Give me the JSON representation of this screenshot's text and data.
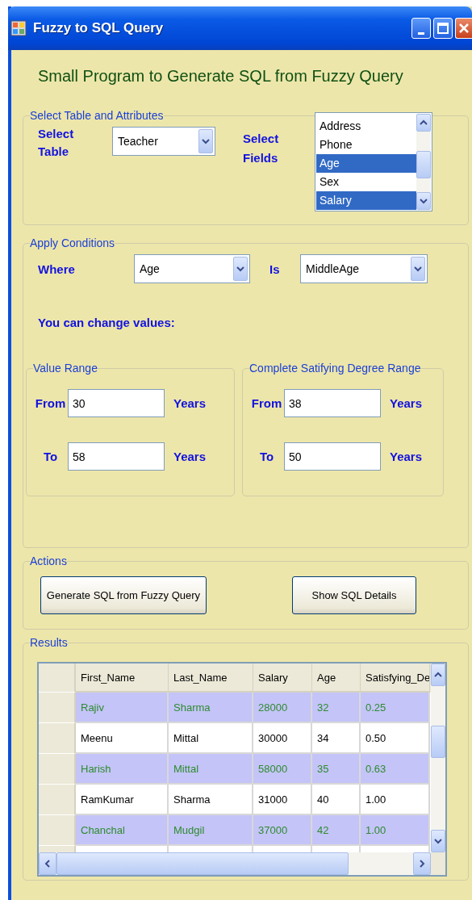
{
  "window": {
    "title": "Fuzzy to SQL Query"
  },
  "heading": "Small Program to Generate SQL from Fuzzy Query",
  "table_group": {
    "title": "Select Table and Attributes",
    "table_label": "Select Table",
    "table_value": "Teacher",
    "fields_label": "Select Fields",
    "fields": [
      {
        "label": "Address",
        "selected": false
      },
      {
        "label": "Phone",
        "selected": false
      },
      {
        "label": "Age",
        "selected": true
      },
      {
        "label": "Sex",
        "selected": false
      },
      {
        "label": "Salary",
        "selected": true
      }
    ]
  },
  "conditions": {
    "title": "Apply Conditions",
    "where_label": "Where",
    "attribute": "Age",
    "is_label": "Is",
    "term": "MiddleAge",
    "hint": "You can change values:",
    "ranges": [
      {
        "title": "Value Range",
        "rows": [
          {
            "label": "From",
            "value": "30",
            "unit": "Years"
          },
          {
            "label": "To",
            "value": "58",
            "unit": "Years"
          }
        ]
      },
      {
        "title": "Complete Satifying Degree Range",
        "rows": [
          {
            "label": "From",
            "value": "38",
            "unit": "Years"
          },
          {
            "label": "To",
            "value": "50",
            "unit": "Years"
          }
        ]
      }
    ]
  },
  "actions": {
    "title": "Actions",
    "buttons": [
      "Generate SQL from Fuzzy Query",
      "Show SQL Details"
    ]
  },
  "results": {
    "title": "Results",
    "columns": [
      "First_Name",
      "Last_Name",
      "Salary",
      "Age",
      "Satisfying_De"
    ],
    "rows": [
      {
        "cells": [
          "Rajiv",
          "Sharma",
          "28000",
          "32",
          "0.25"
        ],
        "highlighted": true
      },
      {
        "cells": [
          "Meenu",
          "Mittal",
          "30000",
          "34",
          "0.50"
        ],
        "highlighted": false
      },
      {
        "cells": [
          "Harish",
          "Mittal",
          "58000",
          "35",
          "0.63"
        ],
        "highlighted": true
      },
      {
        "cells": [
          "RamKumar",
          "Sharma",
          "31000",
          "40",
          "1.00"
        ],
        "highlighted": false
      },
      {
        "cells": [
          "Chanchal",
          "Mudgil",
          "37000",
          "42",
          "1.00"
        ],
        "highlighted": true
      }
    ]
  }
}
